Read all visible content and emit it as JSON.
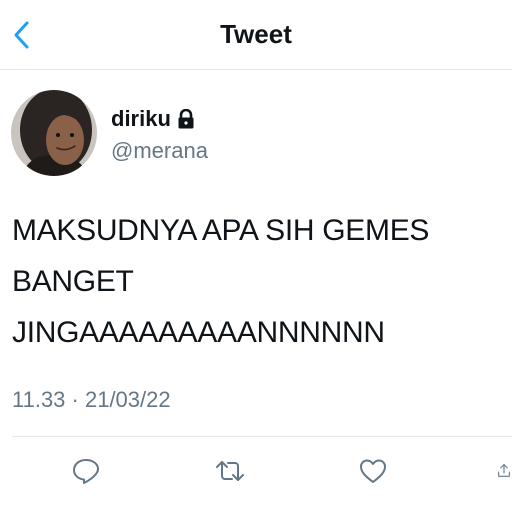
{
  "header": {
    "title": "Tweet",
    "back_icon": "chevron-left-icon",
    "accent_color": "#1da1f2"
  },
  "author": {
    "display_name": "diriku",
    "handle": "@merana",
    "lock_icon": "lock-icon"
  },
  "tweet": {
    "lines": [
      "MAKSUDNYA APA SIH GEMES",
      "BANGET",
      "JINGAAAAAAAAANNNNNN"
    ],
    "timestamp": "11.33 · 21/03/22"
  },
  "actions": [
    {
      "icon": "reply-icon"
    },
    {
      "icon": "retweet-icon"
    },
    {
      "icon": "like-icon"
    },
    {
      "icon": "share-icon"
    }
  ]
}
